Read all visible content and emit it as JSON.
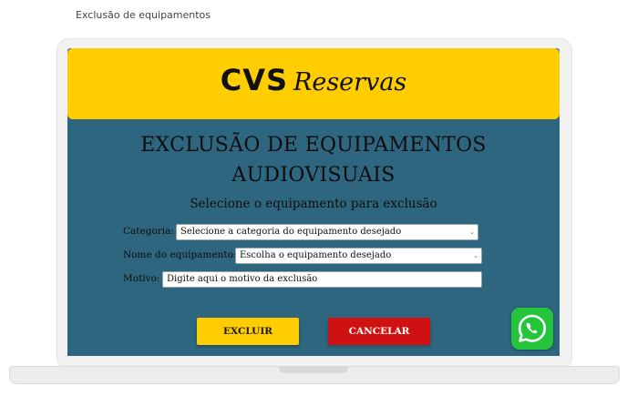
{
  "page": {
    "caption": "Exclusão de equipamentos"
  },
  "brand": {
    "cvs": "CVS",
    "reservas": "Reservas",
    "color": "#ffcd00"
  },
  "form": {
    "title_line1": "EXCLUSÃO DE EQUIPAMENTOS",
    "title_line2": "AUDIOVISUAIS",
    "subtitle": "Selecione o equipamento para exclusão",
    "categoria": {
      "label": "Categoria:",
      "value": "Selecione a categoria do equipamento desejado"
    },
    "nome": {
      "label": "Nome do equipamento:",
      "value": "Escolha o equipamento desejado"
    },
    "motivo": {
      "label": "Motivo:",
      "placeholder": "Digite aqui o motivo da exclusão"
    }
  },
  "buttons": {
    "excluir": "EXCLUIR",
    "cancelar": "CANCELAR"
  },
  "colors": {
    "panel": "#2e6680",
    "excluir": "#ffcd00",
    "cancelar": "#cf1111",
    "whatsapp": "#25c53b"
  },
  "icons": {
    "chat": "whatsapp-icon",
    "caret": "chevron-down-icon"
  }
}
